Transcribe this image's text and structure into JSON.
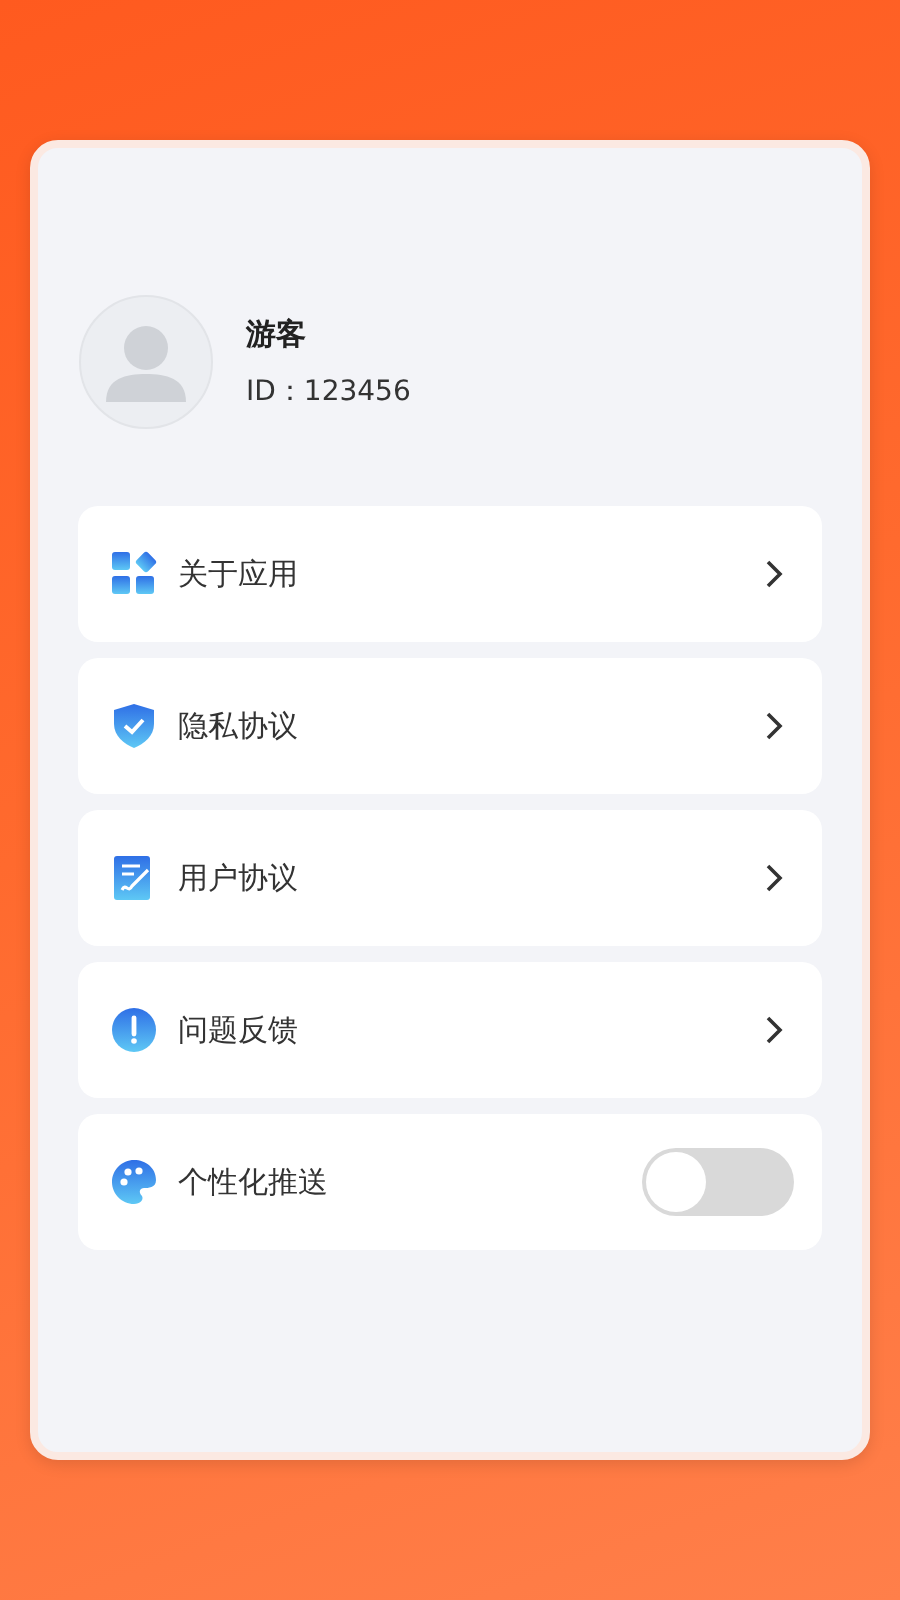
{
  "profile": {
    "name": "游客",
    "id": "ID：123456"
  },
  "menu": [
    {
      "kind": "link",
      "label": "关于应用"
    },
    {
      "kind": "link",
      "label": "隐私协议"
    },
    {
      "kind": "link",
      "label": "用户协议"
    },
    {
      "kind": "link",
      "label": "问题反馈"
    },
    {
      "kind": "toggle",
      "label": "个性化推送",
      "on": false
    }
  ]
}
